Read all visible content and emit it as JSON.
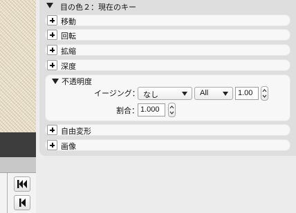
{
  "panel": {
    "title": "目の色２：現在のキー",
    "sections": {
      "move": "移動",
      "rotate": "回転",
      "scale": "拡縮",
      "depth": "深度",
      "free_transform": "自由変形",
      "image": "画像"
    },
    "opacity": {
      "label": "不透明度",
      "easing_label": "イージング：",
      "easing_value": "なし",
      "mode_value": "All",
      "easing_amount": "1.00",
      "ratio_label": "割合：",
      "ratio_value": "1.000"
    }
  },
  "timeline": {
    "buttons": [
      "skip-to-start",
      "step-back"
    ]
  }
}
